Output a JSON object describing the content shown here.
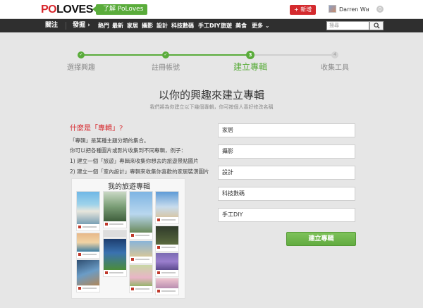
{
  "header": {
    "logo_prefix": "PO",
    "logo_suffix": "LOVES",
    "about_label": "了解 PoLoves",
    "add_label": "+ 新增",
    "username": "Darren Wu",
    "user_caret": "⌄",
    "notif_count": "0"
  },
  "nav": {
    "items": [
      {
        "label": "關注"
      },
      {
        "label": "發掘 ›"
      },
      {
        "label": "熱門"
      },
      {
        "label": "最新"
      },
      {
        "label": "家居"
      },
      {
        "label": "攝影"
      },
      {
        "label": "設計"
      },
      {
        "label": "科技數碼"
      },
      {
        "label": "手工DIY"
      },
      {
        "label": "旅遊"
      },
      {
        "label": "美食"
      },
      {
        "label": "更多 ⌄"
      }
    ],
    "search_placeholder": "搜尋"
  },
  "steps": [
    {
      "label": "選擇興趣",
      "dot": "✓",
      "state": "done"
    },
    {
      "label": "註冊帳號",
      "dot": "✓",
      "state": "done"
    },
    {
      "label": "建立專輯",
      "dot": "3",
      "state": "current"
    },
    {
      "label": "收集工具",
      "dot": "4",
      "state": "todo"
    }
  ],
  "main": {
    "title": "以你的興趣來建立專輯",
    "subtitle": "我們將為你建立以下幾個專輯，你可按個人喜好修改名稱"
  },
  "info": {
    "heading": "什麼是「專輯」?",
    "lines": [
      "「專輯」是某種主題分類的集合。",
      "你可以把各種圖片或影片收集到不同專輯，例子：",
      "1) 建立一個「旅遊」專輯來收集你想去的旅遊景點圖片",
      "2) 建立一個「室內設計」專輯來收集你喜歡的家居裝潢圖片"
    ],
    "collage_title": "我的旅遊專輯"
  },
  "albums": [
    "家居",
    "攝影",
    "設計",
    "科技數碼",
    "手工DIY"
  ],
  "create_label": "建立專輯",
  "colors": {
    "brand_red": "#d7262b",
    "brand_green": "#5aac3b",
    "nav_bg": "#2f2f2f",
    "page_bg": "#e6e6e6"
  }
}
